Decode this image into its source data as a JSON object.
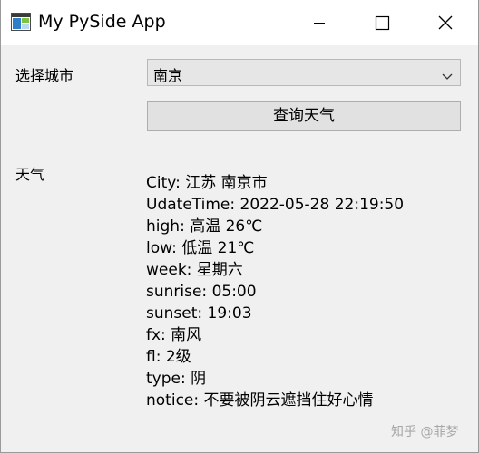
{
  "window": {
    "title": "My PySide App"
  },
  "form": {
    "city_label": "选择城市",
    "city_selected": "南京",
    "query_button": "查询天气",
    "weather_label": "天气"
  },
  "weather": {
    "lines": [
      "City: 江苏 南京市",
      "UdateTime: 2022-05-28 22:19:50",
      "high: 高温 26℃",
      "low: 低温 21℃",
      "week: 星期六",
      "sunrise: 05:00",
      "sunset: 19:03",
      "fx: 南风",
      "fl: 2级",
      "type: 阴",
      "notice: 不要被阴云遮挡住好心情"
    ]
  },
  "watermark": "知乎 @菲梦",
  "icons": {
    "app": "app-window-icon",
    "minimize": "minimize-icon",
    "maximize": "maximize-icon",
    "close": "close-icon",
    "dropdown": "chevron-down-icon"
  }
}
